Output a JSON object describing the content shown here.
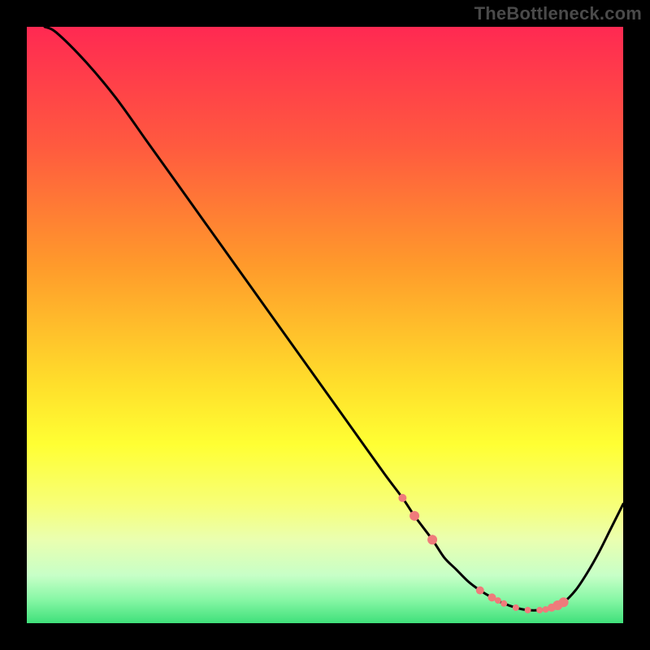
{
  "watermark": "TheBottleneck.com",
  "colors": {
    "gradient_stops": [
      {
        "offset": 0.0,
        "color": "#ff2952"
      },
      {
        "offset": 0.2,
        "color": "#ff5a3f"
      },
      {
        "offset": 0.4,
        "color": "#ff9a2b"
      },
      {
        "offset": 0.6,
        "color": "#ffdf2b"
      },
      {
        "offset": 0.7,
        "color": "#ffff33"
      },
      {
        "offset": 0.8,
        "color": "#f7ff77"
      },
      {
        "offset": 0.86,
        "color": "#eaffb0"
      },
      {
        "offset": 0.92,
        "color": "#c7ffc7"
      },
      {
        "offset": 0.96,
        "color": "#88f7a6"
      },
      {
        "offset": 1.0,
        "color": "#3fe07a"
      }
    ],
    "curve": "#000000",
    "marker": "#ef7b7b"
  },
  "chart_data": {
    "type": "line",
    "title": "",
    "xlabel": "",
    "ylabel": "",
    "xlim": [
      0,
      100
    ],
    "ylim": [
      0,
      100
    ],
    "series": [
      {
        "name": "bottleneck-curve",
        "x": [
          3,
          5,
          10,
          15,
          20,
          25,
          30,
          35,
          40,
          45,
          50,
          55,
          60,
          63,
          65,
          68,
          70,
          72,
          74,
          76,
          78,
          80,
          82,
          84,
          86,
          88,
          90,
          92,
          94,
          96,
          98,
          100
        ],
        "y": [
          100,
          99,
          94,
          88,
          81,
          74,
          67,
          60,
          53,
          46,
          39,
          32,
          25,
          21,
          18,
          14,
          11,
          9,
          7,
          5.5,
          4.3,
          3.3,
          2.6,
          2.2,
          2.2,
          2.6,
          3.5,
          5.5,
          8.5,
          12,
          16,
          20
        ]
      }
    ],
    "markers": {
      "name": "optimum-points",
      "x": [
        63,
        65,
        68,
        76,
        78,
        79,
        80,
        82,
        84,
        86,
        87,
        88,
        89,
        90
      ],
      "y": [
        21,
        18,
        14,
        5.5,
        4.3,
        3.8,
        3.3,
        2.6,
        2.2,
        2.2,
        2.3,
        2.6,
        3.0,
        3.5
      ],
      "r": [
        5,
        6,
        6,
        5,
        5,
        4,
        4,
        4,
        4,
        4,
        4,
        5,
        6,
        6
      ]
    }
  }
}
